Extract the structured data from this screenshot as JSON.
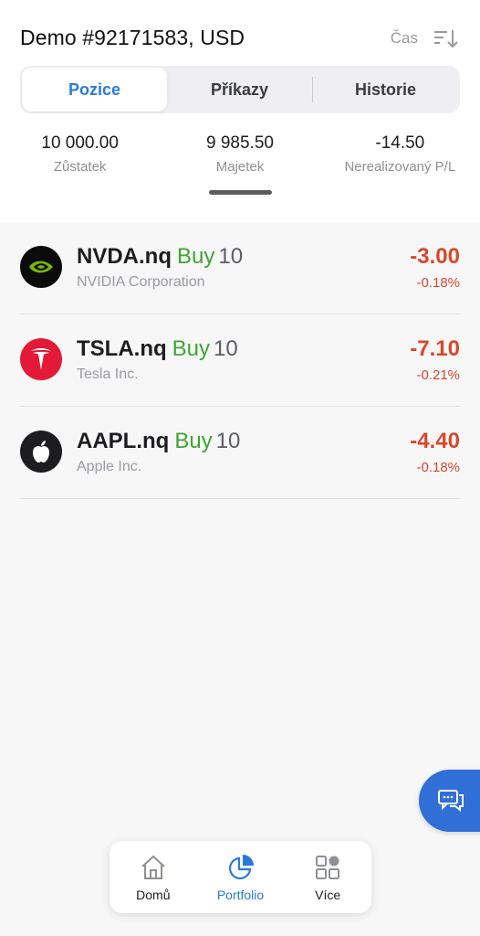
{
  "header": {
    "account_title": "Demo #92171583, USD",
    "sort_label": "Čas"
  },
  "tabs": [
    {
      "label": "Pozice",
      "active": true
    },
    {
      "label": "Příkazy",
      "active": false
    },
    {
      "label": "Historie",
      "active": false
    }
  ],
  "summary": [
    {
      "value": "10 000.00",
      "label": "Zůstatek"
    },
    {
      "value": "9 985.50",
      "label": "Majetek"
    },
    {
      "value": "-14.50",
      "label": "Nerealizovaný P/L"
    }
  ],
  "positions": [
    {
      "symbol": "NVDA.nq",
      "side": "Buy",
      "qty": "10",
      "company": "NVIDIA Corporation",
      "pl": "-3.00",
      "pl_pct": "-0.18%",
      "logo_icon": "nvidia-logo-icon"
    },
    {
      "symbol": "TSLA.nq",
      "side": "Buy",
      "qty": "10",
      "company": "Tesla Inc.",
      "pl": "-7.10",
      "pl_pct": "-0.21%",
      "logo_icon": "tesla-logo-icon"
    },
    {
      "symbol": "AAPL.nq",
      "side": "Buy",
      "qty": "10",
      "company": "Apple Inc.",
      "pl": "-4.40",
      "pl_pct": "-0.18%",
      "logo_icon": "apple-logo-icon"
    }
  ],
  "bottom_nav": [
    {
      "label": "Domů",
      "icon": "home-icon",
      "active": false
    },
    {
      "label": "Portfolio",
      "icon": "pie-chart-icon",
      "active": true
    },
    {
      "label": "Více",
      "icon": "grid-icon",
      "active": false
    }
  ],
  "colors": {
    "accent": "#2b7ad9",
    "buy": "#3da632",
    "loss": "#d9472b",
    "fab": "#2f6fd6"
  }
}
